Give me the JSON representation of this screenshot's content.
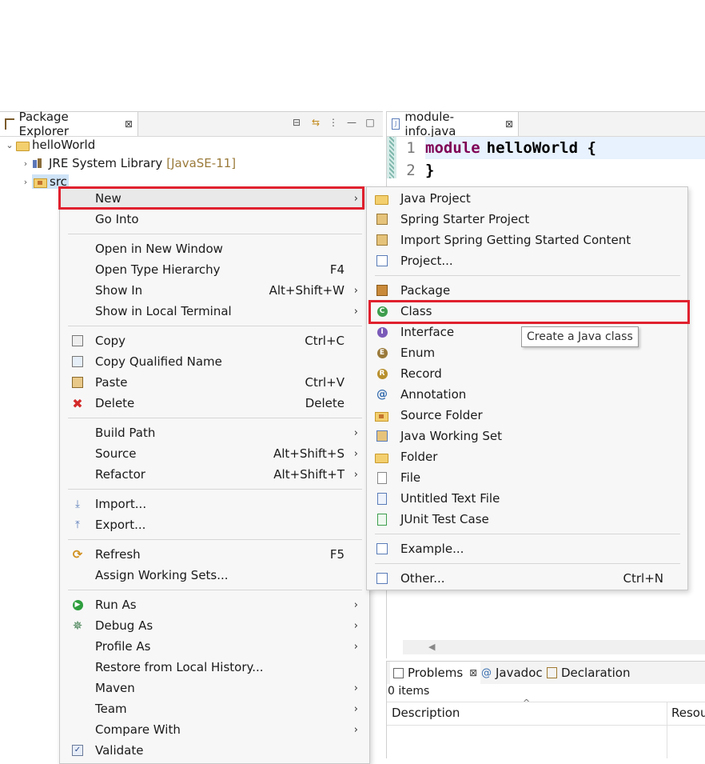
{
  "package_explorer": {
    "tab_label": "Package Explorer",
    "tree": {
      "project": "helloWorld",
      "jre_label": "JRE System Library",
      "jre_version": "[JavaSE-11]",
      "src": "src"
    }
  },
  "editor": {
    "tab_label": "module-info.java",
    "lines": [
      {
        "no": "1",
        "keyword": "module",
        "text": "helloWorld {"
      },
      {
        "no": "2",
        "keyword": "",
        "text": "}"
      }
    ]
  },
  "problems": {
    "tabs": [
      "Problems",
      "Javadoc",
      "Declaration"
    ],
    "count": "0 items",
    "columns": [
      "Description",
      "Resou"
    ]
  },
  "context_menu": {
    "items": [
      {
        "label": "New",
        "accel": ""
      },
      {
        "label": "Go Into",
        "accel": ""
      },
      {
        "label": "Open in New Window",
        "accel": ""
      },
      {
        "label": "Open Type Hierarchy",
        "accel": "F4"
      },
      {
        "label": "Show In",
        "accel": "Alt+Shift+W"
      },
      {
        "label": "Show in Local Terminal",
        "accel": ""
      },
      {
        "label": "Copy",
        "accel": "Ctrl+C"
      },
      {
        "label": "Copy Qualified Name",
        "accel": ""
      },
      {
        "label": "Paste",
        "accel": "Ctrl+V"
      },
      {
        "label": "Delete",
        "accel": "Delete"
      },
      {
        "label": "Build Path",
        "accel": ""
      },
      {
        "label": "Source",
        "accel": "Alt+Shift+S"
      },
      {
        "label": "Refactor",
        "accel": "Alt+Shift+T"
      },
      {
        "label": "Import...",
        "accel": ""
      },
      {
        "label": "Export...",
        "accel": ""
      },
      {
        "label": "Refresh",
        "accel": "F5"
      },
      {
        "label": "Assign Working Sets...",
        "accel": ""
      },
      {
        "label": "Run As",
        "accel": ""
      },
      {
        "label": "Debug As",
        "accel": ""
      },
      {
        "label": "Profile As",
        "accel": ""
      },
      {
        "label": "Restore from Local History...",
        "accel": ""
      },
      {
        "label": "Maven",
        "accel": ""
      },
      {
        "label": "Team",
        "accel": ""
      },
      {
        "label": "Compare With",
        "accel": ""
      },
      {
        "label": "Validate",
        "accel": ""
      }
    ]
  },
  "new_submenu": {
    "items": [
      {
        "label": "Java Project",
        "accel": ""
      },
      {
        "label": "Spring Starter Project",
        "accel": ""
      },
      {
        "label": "Import Spring Getting Started Content",
        "accel": ""
      },
      {
        "label": "Project...",
        "accel": ""
      },
      {
        "label": "Package",
        "accel": ""
      },
      {
        "label": "Class",
        "accel": ""
      },
      {
        "label": "Interface",
        "accel": ""
      },
      {
        "label": "Enum",
        "accel": ""
      },
      {
        "label": "Record",
        "accel": ""
      },
      {
        "label": "Annotation",
        "accel": ""
      },
      {
        "label": "Source Folder",
        "accel": ""
      },
      {
        "label": "Java Working Set",
        "accel": ""
      },
      {
        "label": "Folder",
        "accel": ""
      },
      {
        "label": "File",
        "accel": ""
      },
      {
        "label": "Untitled Text File",
        "accel": ""
      },
      {
        "label": "JUnit Test Case",
        "accel": ""
      },
      {
        "label": "Example...",
        "accel": ""
      },
      {
        "label": "Other...",
        "accel": "Ctrl+N"
      }
    ]
  },
  "tooltip": "Create a Java class",
  "colors": {
    "highlight_box": "#e0202e",
    "keyword": "#7f0055"
  }
}
